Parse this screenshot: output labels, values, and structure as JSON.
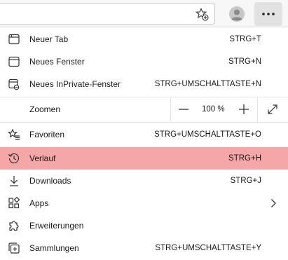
{
  "toolbar": {
    "icons": [
      "add-favorite-icon",
      "profile-icon",
      "more-icon"
    ]
  },
  "menu": {
    "items_top": [
      {
        "label": "Neuer Tab",
        "shortcut": "STRG+T",
        "icon": "new-tab-icon"
      },
      {
        "label": "Neues Fenster",
        "shortcut": "STRG+N",
        "icon": "new-window-icon"
      },
      {
        "label": "Neues InPrivate-Fenster",
        "shortcut": "STRG+UMSCHALTTASTE+N",
        "icon": "inprivate-icon"
      }
    ],
    "zoom": {
      "label": "Zoomen",
      "value": "100 %"
    },
    "items_bottom": [
      {
        "label": "Favoriten",
        "shortcut": "STRG+UMSCHALTTASTE+O",
        "icon": "favorites-icon"
      },
      {
        "label": "Verlauf",
        "shortcut": "STRG+H",
        "icon": "history-icon",
        "highlighted": true
      },
      {
        "label": "Downloads",
        "shortcut": "STRG+J",
        "icon": "download-icon"
      },
      {
        "label": "Apps",
        "shortcut": "",
        "icon": "apps-icon",
        "submenu": true
      },
      {
        "label": "Erweiterungen",
        "shortcut": "",
        "icon": "extensions-icon"
      },
      {
        "label": "Sammlungen",
        "shortcut": "STRG+UMSCHALTTASTE+Y",
        "icon": "collections-icon"
      }
    ]
  },
  "colors": {
    "highlight": "#f5a6a6",
    "toolbar_bg": "#f7f7f7",
    "more_button_bg": "#e2e2e2"
  }
}
